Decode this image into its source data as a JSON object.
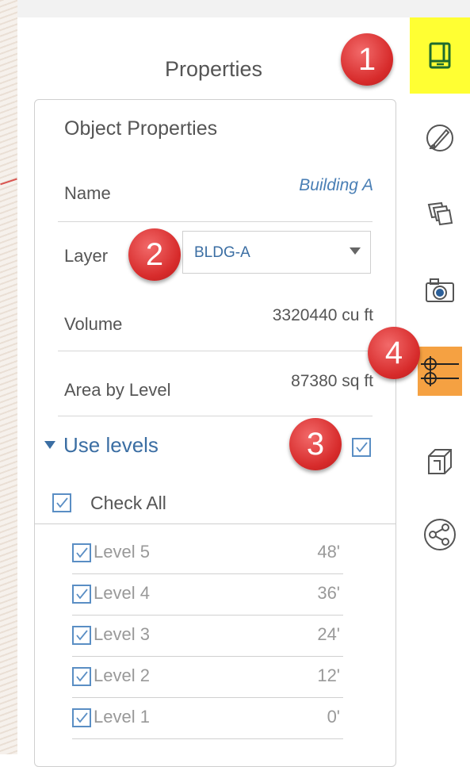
{
  "panel": {
    "title": "Properties"
  },
  "object_properties": {
    "title": "Object Properties",
    "name_label": "Name",
    "name_value": "Building A",
    "layer_label": "Layer",
    "layer_value": "BLDG-A",
    "volume_label": "Volume",
    "volume_value": "3320440 cu ft",
    "area_label": "Area by Level",
    "area_value": "87380 sq ft"
  },
  "use_levels": {
    "label": "Use levels",
    "checked": true,
    "check_all_label": "Check All",
    "levels": [
      {
        "name": "Level 5",
        "elevation": "48'",
        "checked": true
      },
      {
        "name": "Level 4",
        "elevation": "36'",
        "checked": true
      },
      {
        "name": "Level 3",
        "elevation": "24'",
        "checked": true
      },
      {
        "name": "Level 2",
        "elevation": "12'",
        "checked": true
      },
      {
        "name": "Level 1",
        "elevation": "0'",
        "checked": true
      }
    ]
  },
  "toolbar": {
    "icons": [
      "properties-icon",
      "materials-brush-icon",
      "layers-icon",
      "camera-icon",
      "levels-icon",
      "massing-icon",
      "share-icon"
    ]
  },
  "callouts": [
    "1",
    "2",
    "3",
    "4"
  ],
  "colors": {
    "accent": "#3b6ea3",
    "highlight_yellow": "#ffff33",
    "highlight_orange": "#f5a142",
    "callout_red": "#d72b2b"
  }
}
